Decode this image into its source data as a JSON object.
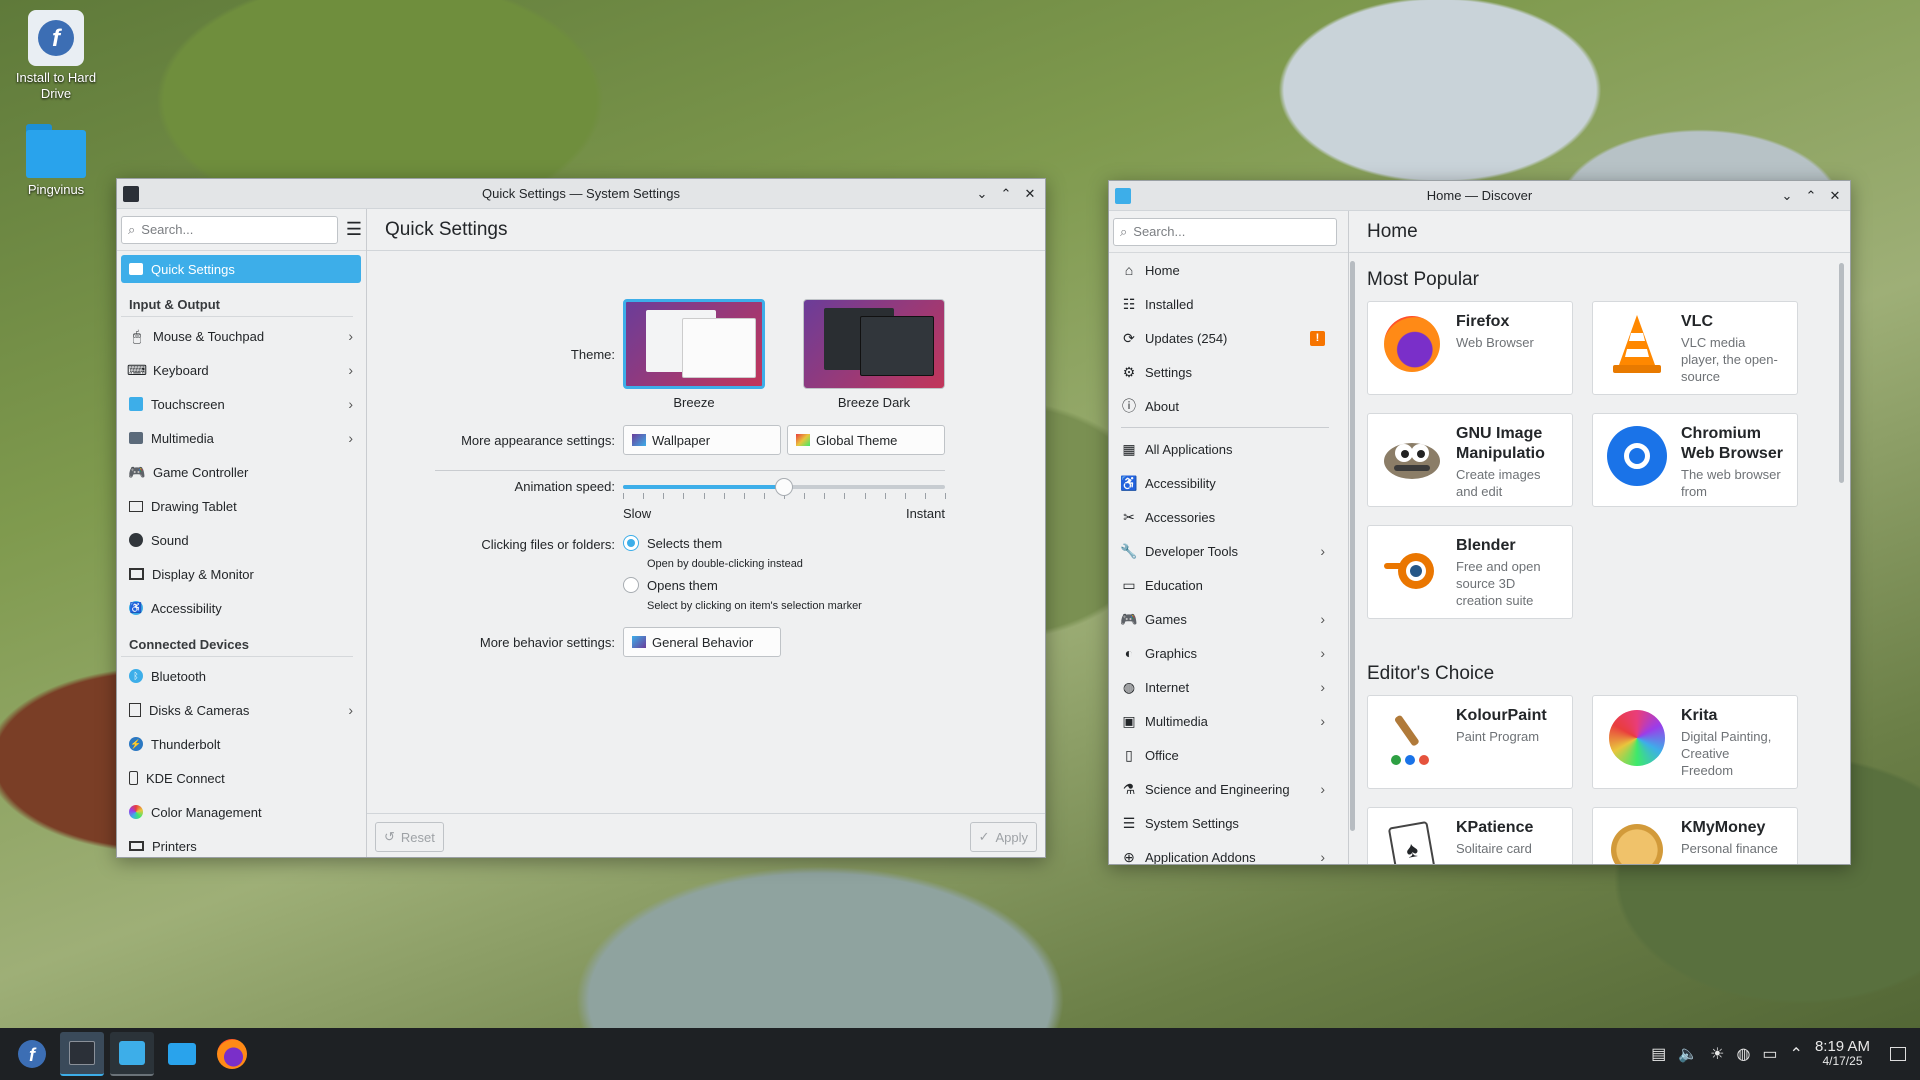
{
  "desktop": {
    "icons": [
      {
        "label": "Install to Hard Drive"
      },
      {
        "label": "Pingvinus"
      }
    ]
  },
  "settings": {
    "title": "Quick Settings — System Settings",
    "search_placeholder": "Search...",
    "page_title": "Quick Settings",
    "sidebar": {
      "selected": "Quick Settings",
      "section_input": "Input & Output",
      "input_items": [
        "Mouse & Touchpad",
        "Keyboard",
        "Touchscreen",
        "Multimedia",
        "Game Controller",
        "Drawing Tablet",
        "Sound",
        "Display & Monitor",
        "Accessibility"
      ],
      "section_devices": "Connected Devices",
      "device_items": [
        "Bluetooth",
        "Disks & Cameras",
        "Thunderbolt",
        "KDE Connect",
        "Color Management",
        "Printers"
      ]
    },
    "theme_label": "Theme:",
    "themes": [
      "Breeze",
      "Breeze Dark"
    ],
    "appearance_label": "More appearance settings:",
    "wallpaper_btn": "Wallpaper",
    "global_theme_btn": "Global Theme",
    "animation_label": "Animation speed:",
    "animation_value": 0.5,
    "slow": "Slow",
    "instant": "Instant",
    "clicking_label": "Clicking files or folders:",
    "opt1": "Selects them",
    "opt1_hint": "Open by double-clicking instead",
    "opt2": "Opens them",
    "opt2_hint": "Select by clicking on item's selection marker",
    "behavior_label": "More behavior settings:",
    "general_behavior_btn": "General Behavior",
    "reset": "Reset",
    "apply": "Apply"
  },
  "discover": {
    "title": "Home — Discover",
    "search_placeholder": "Search...",
    "page_title": "Home",
    "nav_top": [
      "Home",
      "Installed",
      "Updates (254)",
      "Settings",
      "About"
    ],
    "nav_cats": [
      "All Applications",
      "Accessibility",
      "Accessories",
      "Developer Tools",
      "Education",
      "Games",
      "Graphics",
      "Internet",
      "Multimedia",
      "Office",
      "Science and Engineering",
      "System Settings",
      "Application Addons"
    ],
    "most_popular": "Most Popular",
    "editors_choice": "Editor's Choice",
    "popular_apps": [
      {
        "name": "Firefox",
        "desc": "Web Browser"
      },
      {
        "name": "VLC",
        "desc": "VLC media player, the open-source"
      },
      {
        "name": "GNU Image Manipulatio",
        "desc": "Create images and edit"
      },
      {
        "name": "Chromium Web Browser",
        "desc": "The web browser from"
      },
      {
        "name": "Blender",
        "desc": "Free and open source 3D creation suite"
      }
    ],
    "editor_apps": [
      {
        "name": "KolourPaint",
        "desc": "Paint Program"
      },
      {
        "name": "Krita",
        "desc": "Digital Painting, Creative Freedom"
      },
      {
        "name": "KPatience",
        "desc": "Solitaire card"
      },
      {
        "name": "KMyMoney",
        "desc": "Personal finance"
      }
    ]
  },
  "taskbar": {
    "time": "8:19 AM",
    "date": "4/17/25"
  },
  "colors": {
    "accent": "#3daee9",
    "selection": "#3daee9",
    "taskbar": "#1e2124",
    "warning": "#f67400"
  }
}
